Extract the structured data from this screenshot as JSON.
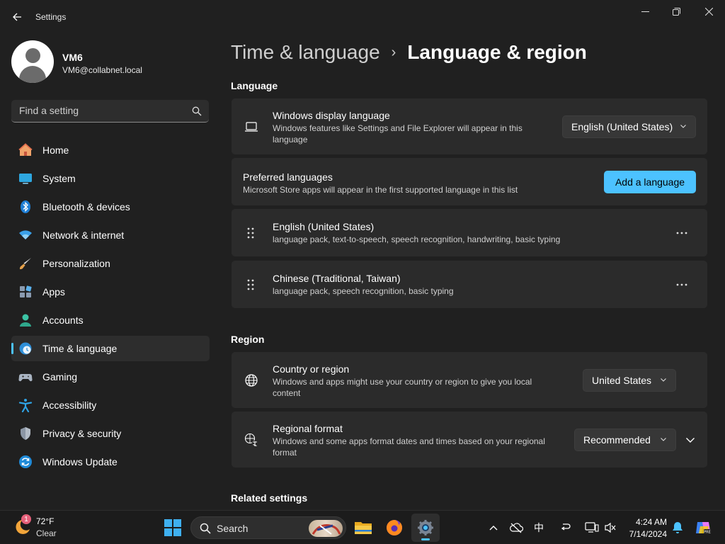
{
  "window": {
    "title": "Settings"
  },
  "profile": {
    "name": "VM6",
    "email": "VM6@collabnet.local"
  },
  "search": {
    "placeholder": "Find a setting"
  },
  "sidebar": {
    "items": [
      {
        "label": "Home",
        "icon": "home-icon"
      },
      {
        "label": "System",
        "icon": "system-icon"
      },
      {
        "label": "Bluetooth & devices",
        "icon": "bluetooth-icon"
      },
      {
        "label": "Network & internet",
        "icon": "wifi-icon"
      },
      {
        "label": "Personalization",
        "icon": "brush-icon"
      },
      {
        "label": "Apps",
        "icon": "apps-icon"
      },
      {
        "label": "Accounts",
        "icon": "accounts-icon"
      },
      {
        "label": "Time & language",
        "icon": "time-language-icon",
        "active": true
      },
      {
        "label": "Gaming",
        "icon": "gamepad-icon"
      },
      {
        "label": "Accessibility",
        "icon": "accessibility-icon"
      },
      {
        "label": "Privacy & security",
        "icon": "shield-icon"
      },
      {
        "label": "Windows Update",
        "icon": "update-icon"
      }
    ]
  },
  "breadcrumb": {
    "parent": "Time & language",
    "separator": "›",
    "current": "Language & region"
  },
  "language_section": {
    "title": "Language",
    "display_language": {
      "title": "Windows display language",
      "description": "Windows features like Settings and File Explorer will appear in this language",
      "value": "English (United States)"
    },
    "preferred": {
      "title": "Preferred languages",
      "description": "Microsoft Store apps will appear in the first supported language in this list",
      "button": "Add a language"
    },
    "languages": [
      {
        "name": "English (United States)",
        "features": "language pack, text-to-speech, speech recognition, handwriting, basic typing"
      },
      {
        "name": "Chinese (Traditional, Taiwan)",
        "features": "language pack, speech recognition, basic typing"
      }
    ]
  },
  "region_section": {
    "title": "Region",
    "country": {
      "title": "Country or region",
      "description": "Windows and apps might use your country or region to give you local content",
      "value": "United States"
    },
    "format": {
      "title": "Regional format",
      "description": "Windows and some apps format dates and times based on your regional format",
      "value": "Recommended"
    }
  },
  "related": {
    "title": "Related settings"
  },
  "taskbar": {
    "weather": {
      "temp": "72°F",
      "desc": "Clear",
      "badge": "1"
    },
    "search_label": "Search",
    "ime": "中",
    "clock": {
      "time": "4:24 AM",
      "date": "7/14/2024"
    }
  },
  "colors": {
    "accent": "#4cc2ff",
    "background": "#202020",
    "card": "#2b2b2b"
  }
}
